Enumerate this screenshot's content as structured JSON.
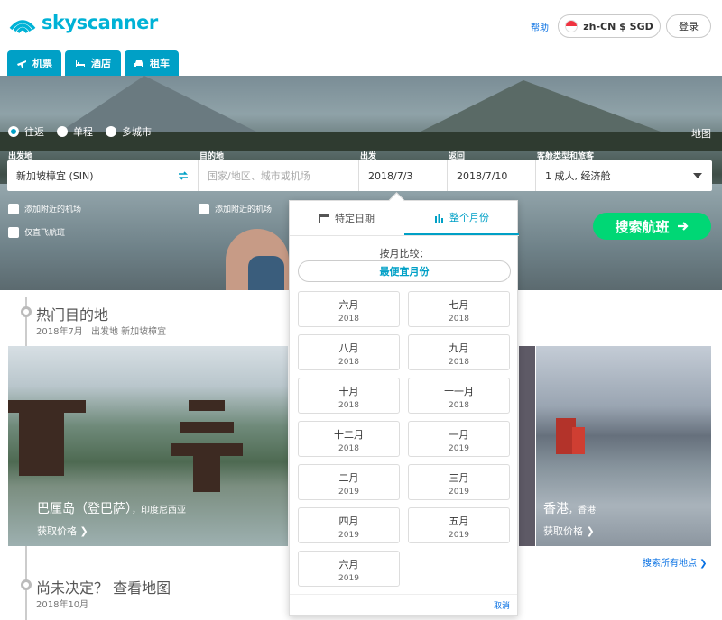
{
  "brand": {
    "name": "skyscanner",
    "color": "#00b2d6"
  },
  "header": {
    "help": "帮助",
    "locale": "zh-CN $ SGD",
    "login": "登录"
  },
  "tabs": [
    {
      "label": "机票",
      "icon": "plane-icon"
    },
    {
      "label": "酒店",
      "icon": "bed-icon"
    },
    {
      "label": "租车",
      "icon": "car-icon"
    }
  ],
  "trip_types": [
    "往返",
    "单程",
    "多城市"
  ],
  "map_link": "地图",
  "search": {
    "from_label": "出发地",
    "from_value": "新加坡樟宜 (SIN)",
    "to_label": "目的地",
    "to_placeholder": "国家/地区、城市或机场",
    "depart_label": "出发",
    "depart_value": "2018/7/3",
    "return_label": "返回",
    "return_value": "2018/7/10",
    "cabin_label": "客舱类型和旅客",
    "cabin_value": "1 成人, 经济舱",
    "nearby_from": "添加附近的机场",
    "nearby_to": "添加附近的机场",
    "direct_only": "仅直飞航班",
    "button": "搜索航班"
  },
  "popular": {
    "title": "热门目的地",
    "subtitle": "2018年7月",
    "origin_note": "出发地 新加坡樟宜",
    "cards": [
      {
        "name": "巴厘岛（登巴萨）",
        "country": "印度尼西亚",
        "link": "获取价格"
      },
      {
        "name": "香港",
        "country": "香港",
        "link": "获取价格"
      }
    ],
    "all_places": "搜索所有地点"
  },
  "undecided": {
    "title": "尚未决定？ 查看地图",
    "subtitle": "2018年10月"
  },
  "date_picker": {
    "tab_specific": "特定日期",
    "tab_month": "整个月份",
    "compare_label": "按月比较：",
    "cheapest_month": "最便宜月份",
    "months": [
      {
        "m": "六月",
        "y": "2018"
      },
      {
        "m": "七月",
        "y": "2018"
      },
      {
        "m": "八月",
        "y": "2018"
      },
      {
        "m": "九月",
        "y": "2018"
      },
      {
        "m": "十月",
        "y": "2018"
      },
      {
        "m": "十一月",
        "y": "2018"
      },
      {
        "m": "十二月",
        "y": "2018"
      },
      {
        "m": "一月",
        "y": "2019"
      },
      {
        "m": "二月",
        "y": "2019"
      },
      {
        "m": "三月",
        "y": "2019"
      },
      {
        "m": "四月",
        "y": "2019"
      },
      {
        "m": "五月",
        "y": "2019"
      },
      {
        "m": "六月",
        "y": "2019"
      }
    ],
    "cancel": "取消"
  },
  "colors": {
    "tab_bg": "#00a0c6",
    "accent": "#00a0c6",
    "search_button": "#00d775",
    "link": "#0770e3"
  }
}
